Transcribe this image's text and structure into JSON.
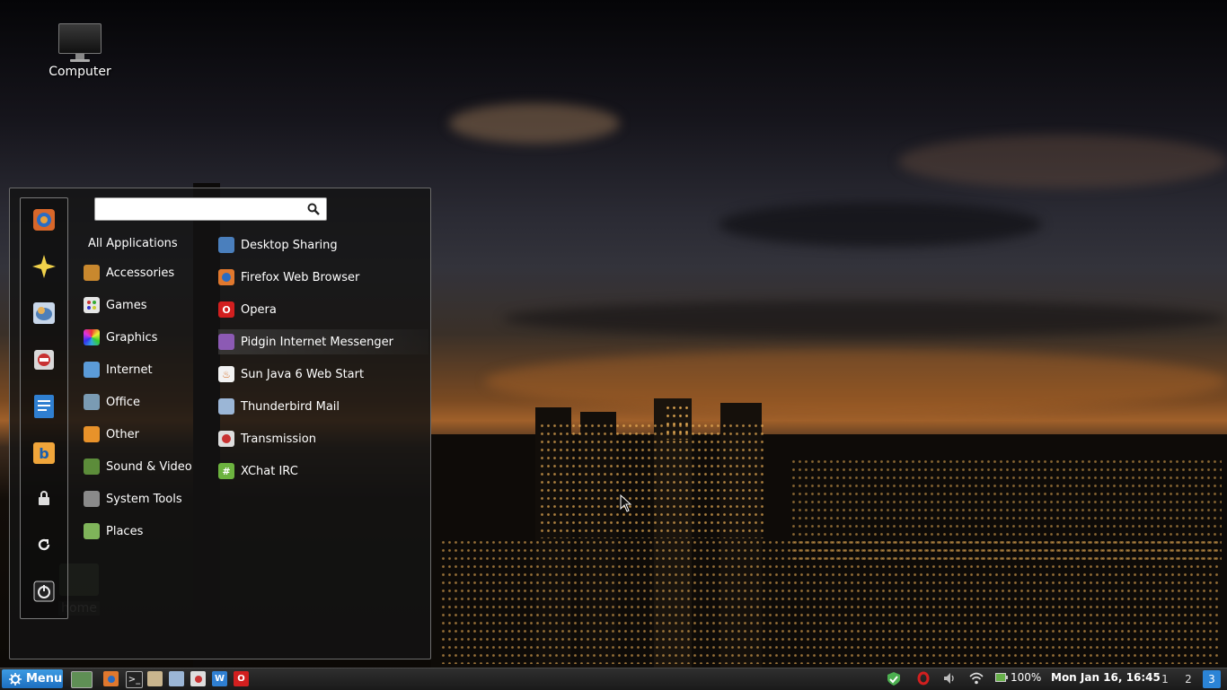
{
  "desktop": {
    "icons": [
      {
        "label": "Computer",
        "icon": "computer-icon"
      },
      {
        "label": "home",
        "icon": "folder-home-icon"
      }
    ]
  },
  "menu": {
    "search": {
      "value": "",
      "placeholder": ""
    },
    "favorites": [
      {
        "name": "Firefox Web Browser",
        "icon": "firefox-icon"
      },
      {
        "name": "Desktop Sharing",
        "icon": "star-icon"
      },
      {
        "name": "Thunderbird Mail",
        "icon": "thunderbird-icon"
      },
      {
        "name": "Transmission",
        "icon": "transmission-icon"
      },
      {
        "name": "Document Viewer",
        "icon": "document-icon"
      },
      {
        "name": "Bluefish",
        "icon": "bluefish-icon"
      }
    ],
    "system_buttons": [
      {
        "name": "Lock Screen",
        "icon": "lock-icon"
      },
      {
        "name": "Logout",
        "icon": "logout-icon"
      },
      {
        "name": "Quit",
        "icon": "power-icon"
      }
    ],
    "categories": [
      {
        "label": "All Applications",
        "icon": ""
      },
      {
        "label": "Accessories",
        "icon": "accessories-icon"
      },
      {
        "label": "Games",
        "icon": "games-icon"
      },
      {
        "label": "Graphics",
        "icon": "graphics-icon"
      },
      {
        "label": "Internet",
        "icon": "internet-icon"
      },
      {
        "label": "Office",
        "icon": "office-icon"
      },
      {
        "label": "Other",
        "icon": "other-icon"
      },
      {
        "label": "Sound & Video",
        "icon": "sound-video-icon"
      },
      {
        "label": "System Tools",
        "icon": "system-tools-icon"
      },
      {
        "label": "Places",
        "icon": "places-folder-icon"
      }
    ],
    "selected_category": "Internet",
    "apps": [
      {
        "label": "Desktop Sharing",
        "icon": "desktop-sharing-icon"
      },
      {
        "label": "Firefox Web Browser",
        "icon": "firefox-icon"
      },
      {
        "label": "Opera",
        "icon": "opera-icon"
      },
      {
        "label": "Pidgin Internet Messenger",
        "icon": "pidgin-icon"
      },
      {
        "label": "Sun Java 6 Web Start",
        "icon": "java-icon"
      },
      {
        "label": "Thunderbird Mail",
        "icon": "thunderbird-icon"
      },
      {
        "label": "Transmission",
        "icon": "transmission-icon"
      },
      {
        "label": "XChat IRC",
        "icon": "xchat-icon"
      }
    ],
    "hovered_app": "Pidgin Internet Messenger"
  },
  "panel": {
    "menu_label": "Menu",
    "launchers": [
      "show-desktop-icon",
      "firefox-icon",
      "terminal-icon",
      "files-icon",
      "thunderbird-icon",
      "transmission-icon",
      "text-editor-icon",
      "opera-icon"
    ],
    "tray": {
      "battery": "100%",
      "clock": "Mon Jan 16, 16:45"
    },
    "workspaces": [
      "1",
      "2",
      "3"
    ],
    "active_workspace": "3"
  },
  "colors": {
    "panel_accent": "#2b84d6",
    "menu_bg": "#141414"
  }
}
